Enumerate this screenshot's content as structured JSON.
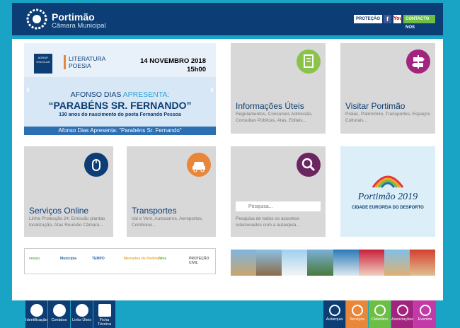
{
  "header": {
    "title": "Portimão",
    "subtitle": "Câmara Municipal",
    "protecao_label": "PROTEÇÃO",
    "facebook_label": "f",
    "youtube_label": "You",
    "contact_label": "CONTACTO NOS"
  },
  "slider": {
    "logo_text": "AGRUP. ESCOLAS",
    "category_line1": "LITERATURA",
    "category_line2": "POESIA",
    "date": "14 NOVEMBRO 2018",
    "time": "15h00",
    "headline_part1": "AFONSO DIAS ",
    "headline_part2": "APRESENTA:",
    "title": "“PARABÉNS SR. FERNANDO”",
    "subtitle": "130 anos do nascimento do poeta Fernando Pessoa",
    "caption": "Afonso Dias Apresenta: \"Parabéns Sr. Fernando\"",
    "prev_label": "‹",
    "next_label": "›"
  },
  "tiles": {
    "informacoes": {
      "title": "Informações Úteis",
      "text": "Regulamentos, Concursos Admissão, Consultas Públicas, Atas, Editais...",
      "icon": "document-icon",
      "color": "#8bc34a"
    },
    "visitar": {
      "title": "Visitar Portimão",
      "text": "Praias, Património, Transportes, Espaços Culturais...",
      "icon": "signpost-icon",
      "color": "#a3247e"
    },
    "servicos": {
      "title": "Serviços Online",
      "text": "Linha Protecção 24, Emissão plantas localização, Atas Reunião Câmara...",
      "icon": "mouse-icon",
      "color": "#0c3d74"
    },
    "transportes": {
      "title": "Transportes",
      "text": "Vai e Vem, Autocarros, Aeroportos, Comboios...",
      "icon": "car-icon",
      "color": "#e8863a"
    },
    "pesquisa": {
      "placeholder": "Pesquisa...",
      "text": "Pesquisa de todos os assuntos relacionados com a autarquia...",
      "icon": "search-icon",
      "color": "#6b2560"
    },
    "desporto": {
      "title": "Portimão 2019",
      "subtitle": "CIDADE EUROPEIA DO DESPORTO"
    }
  },
  "partners": [
    "emarp",
    "Municípia",
    "TEMPO",
    "Mercados de Portimão",
    "Viva",
    "PROTEÇÃO CIVIL"
  ],
  "footer_left": [
    {
      "label": "Identificação",
      "icon": "lock-icon"
    },
    {
      "label": "Contatos",
      "icon": "info-icon"
    },
    {
      "label": "Links Úteis",
      "icon": "link-icon"
    },
    {
      "label": "Ficha Técnica",
      "icon": "clipboard-icon"
    }
  ],
  "footer_right": [
    {
      "label": "Autarquia",
      "icon": "building-icon",
      "color": "#0c3d74"
    },
    {
      "label": "Serviços",
      "icon": "gear-icon",
      "color": "#e8863a"
    },
    {
      "label": "Cidadãos",
      "icon": "person-icon",
      "color": "#6cbf44"
    },
    {
      "label": "Associações",
      "icon": "asterisk-icon",
      "color": "#a3247e"
    },
    {
      "label": "Eventos",
      "icon": "star-icon",
      "color": "#c23aa8"
    }
  ],
  "colors": {
    "navy": "#0c3d74",
    "teal": "#19a3c4",
    "tile": "#d8d8d8"
  }
}
